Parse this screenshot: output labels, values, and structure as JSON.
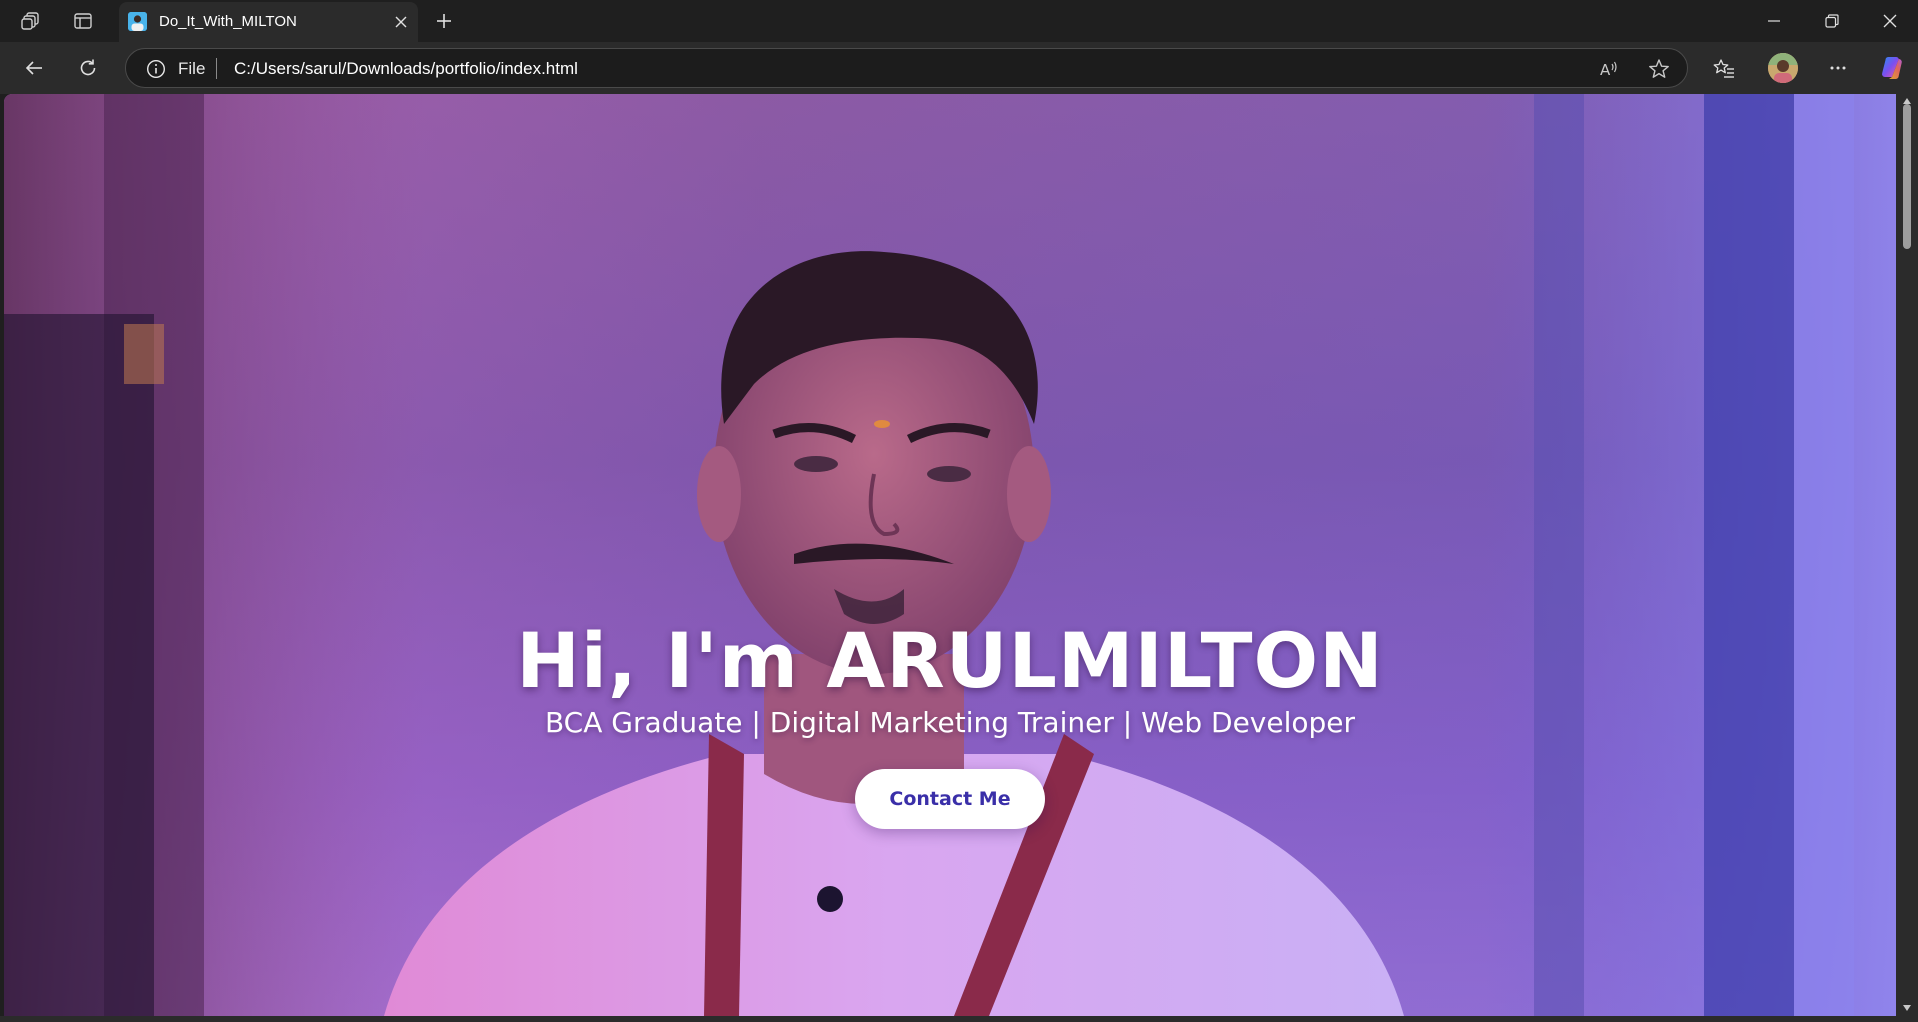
{
  "browser": {
    "tab": {
      "title": "Do_It_With_MILTON",
      "favicon": "profile-photo-favicon"
    },
    "address_bar": {
      "scheme_label": "File",
      "url": "C:/Users/sarul/Downloads/portfolio/index.html"
    },
    "icons": {
      "workspaces": "workspaces-icon",
      "tab_actions": "vertical-tabs-icon",
      "new_tab": "plus-icon",
      "back": "back-arrow-icon",
      "refresh": "refresh-icon",
      "info": "info-icon",
      "read_aloud": "read-aloud-icon",
      "favorite": "star-icon",
      "favorites": "favorites-icon",
      "profile": "avatar",
      "more": "more-icon",
      "copilot": "copilot-icon",
      "minimize": "minimize-icon",
      "restore": "restore-icon",
      "close": "close-icon"
    },
    "colors": {
      "chrome_dark": "#1f1f1f",
      "chrome": "#2b2b2b",
      "address_bg": "#1c1c1c"
    }
  },
  "hero": {
    "heading": "Hi, I'm ARULMILTON",
    "subtitle": "BCA Graduate | Digital Marketing Trainer | Web Developer",
    "cta_label": "Contact Me",
    "colors": {
      "overlay_from": "#8a5aa0",
      "overlay_to": "#9a6fd0",
      "cta_text": "#3a2fa8",
      "cta_bg": "#ffffff",
      "text": "#ffffff"
    }
  }
}
